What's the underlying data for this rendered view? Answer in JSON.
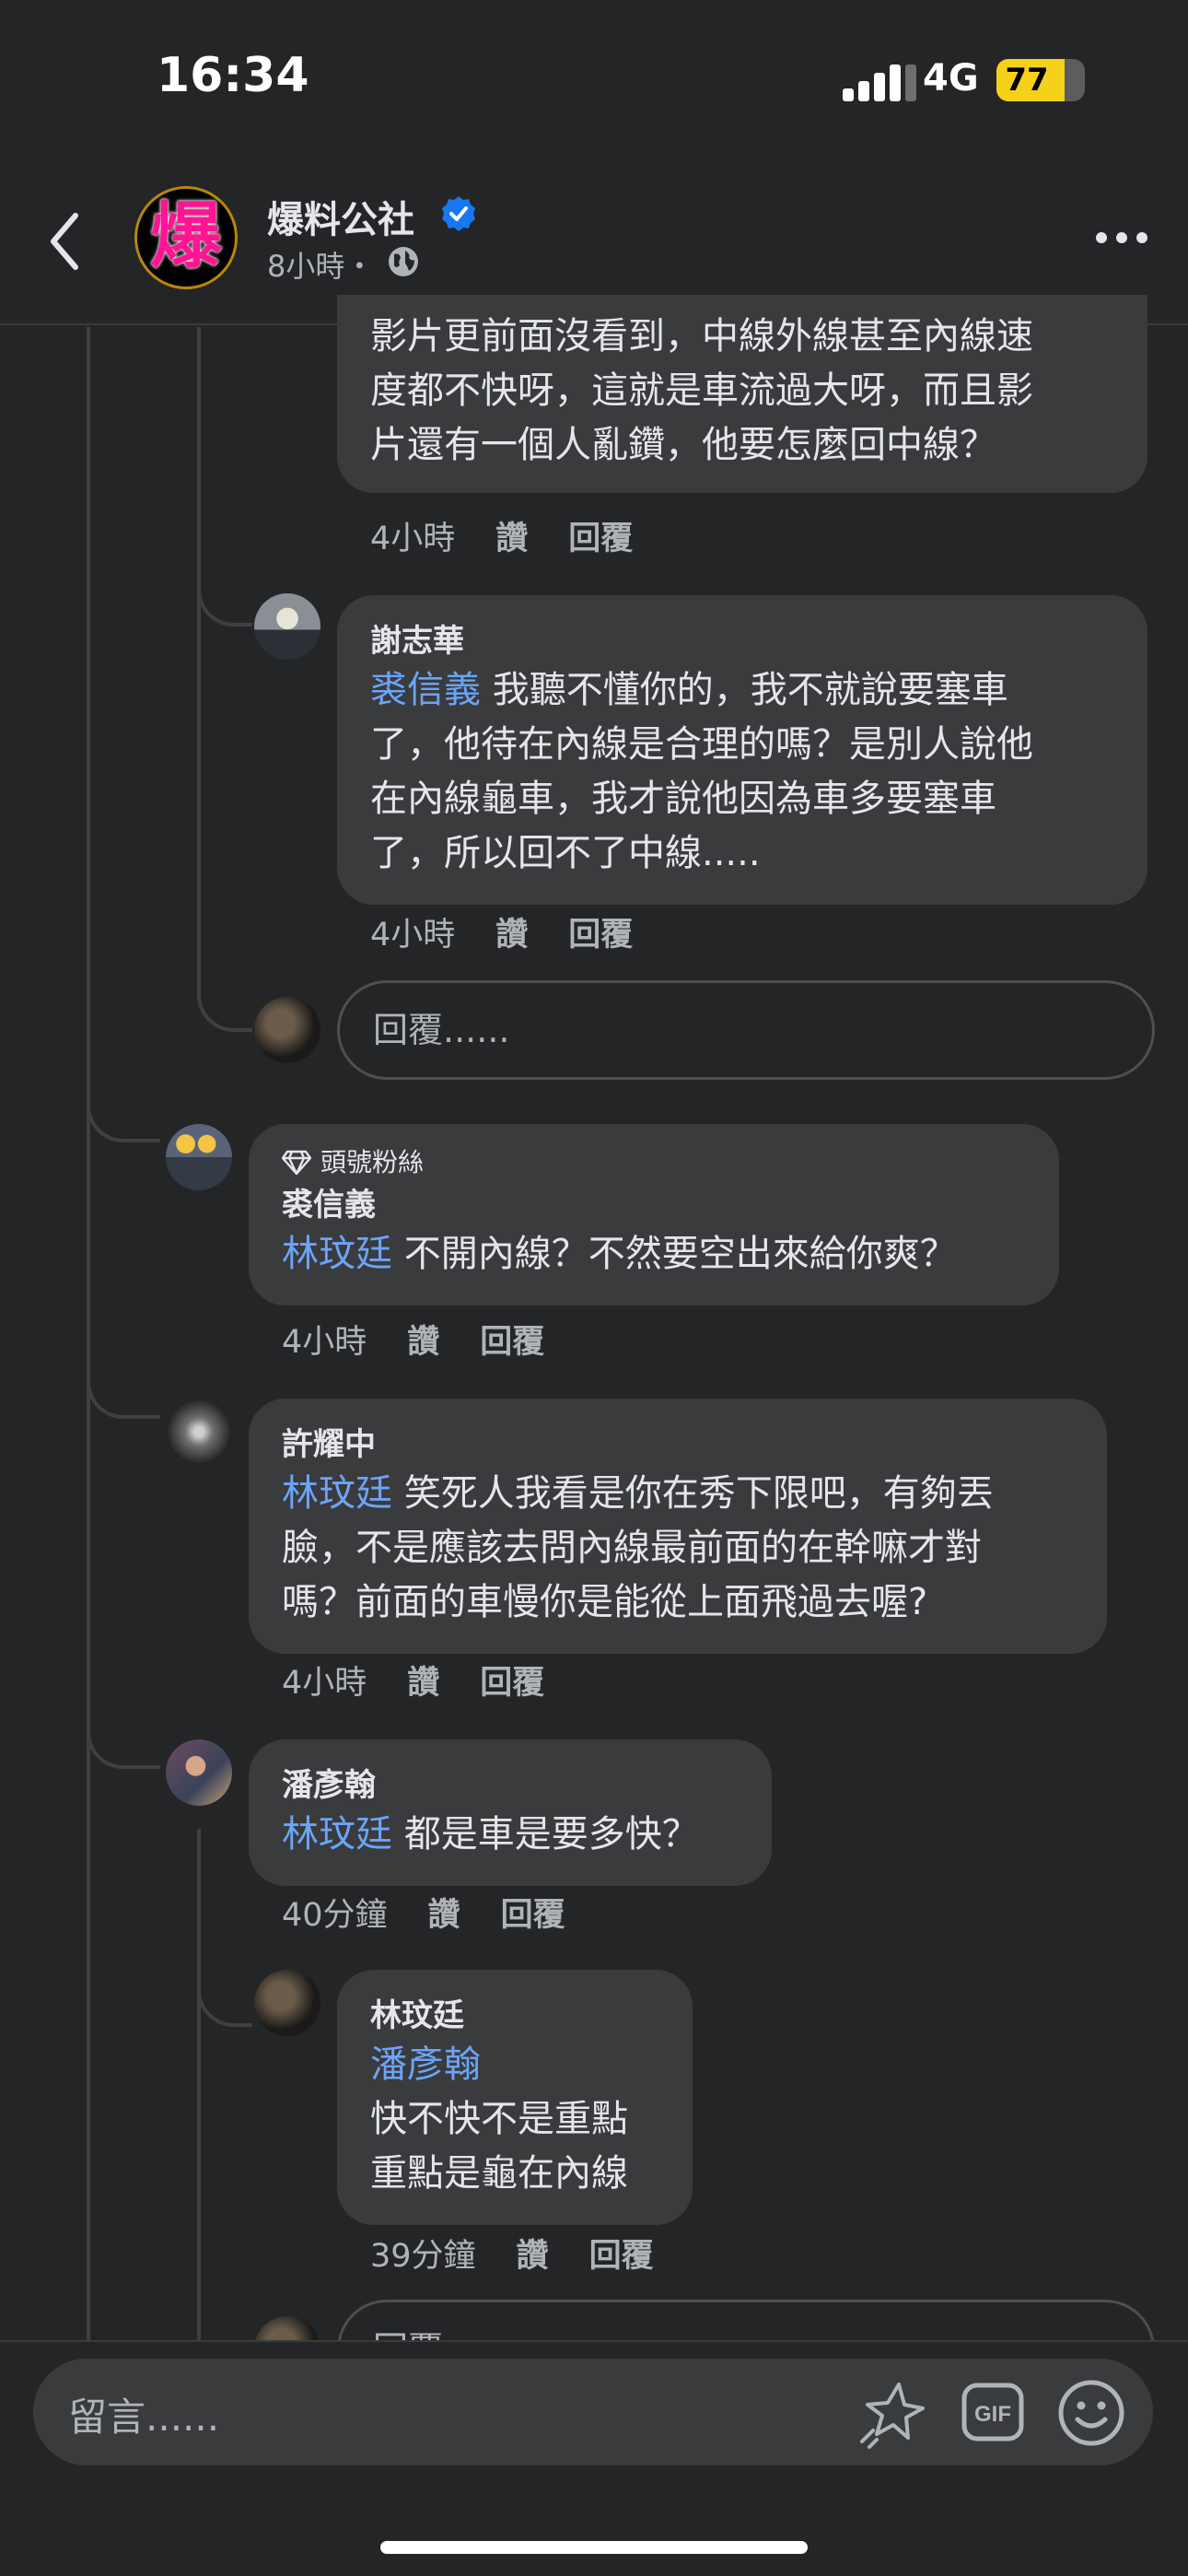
{
  "status_bar": {
    "time": "16:34",
    "network": "4G",
    "battery": "77",
    "battery_level": 0.77
  },
  "header": {
    "page_name": "爆料公社",
    "page_avatar_text": "爆",
    "post_meta": "8小時・",
    "icons": [
      "back-icon",
      "verified-icon",
      "globe-icon",
      "more-icon"
    ]
  },
  "comments": [
    {
      "text_lines": [
        "影片更前面沒看到，中線外線甚至內線速",
        "度都不快呀，這就是車流過大呀，而且影",
        "片還有一個人亂鑽，他要怎麼回中線？"
      ],
      "time": "4小時",
      "like": "讚",
      "reply": "回覆"
    },
    {
      "name": "謝志華",
      "mention": "裘信義",
      "text_lines": [
        " 我聽不懂你的，我不就說要塞車",
        "了，他待在內線是合理的嗎？是別人說他",
        "在內線龜車，我才說他因為車多要塞車",
        "了，所以回不了中線....."
      ],
      "time": "4小時",
      "like": "讚",
      "reply": "回覆"
    },
    {
      "badge": "頭號粉絲",
      "name": "裘信義",
      "mention": "林玟廷",
      "text_lines": [
        " 不開內線？不然要空出來給你爽？"
      ],
      "time": "4小時",
      "like": "讚",
      "reply": "回覆"
    },
    {
      "name": "許耀中",
      "mention": "林玟廷",
      "text_lines": [
        " 笑死人我看是你在秀下限吧，有夠丟",
        "臉，不是應該去問內線最前面的在幹嘛才對",
        "嗎？前面的車慢你是能從上面飛過去喔?"
      ],
      "time": "4小時",
      "like": "讚",
      "reply": "回覆"
    },
    {
      "name": "潘彥翰",
      "mention": "林玟廷",
      "text_lines": [
        " 都是車是要多快？"
      ],
      "time": "40分鐘",
      "like": "讚",
      "reply": "回覆"
    },
    {
      "name": "林玟廷",
      "mention": "潘彥翰",
      "text_lines": [
        "快不快不是重點",
        "重點是龜在內線"
      ],
      "time": "39分鐘",
      "like": "讚",
      "reply": "回覆"
    }
  ],
  "reply_placeholder": "回覆......",
  "reply_placeholder_partial": "回覆",
  "composer": {
    "placeholder": "留言......",
    "icons": [
      "sparkle-icon",
      "gif-icon",
      "emoji-icon"
    ]
  },
  "colors": {
    "background": "#242526",
    "bubble": "#3a3b3c",
    "mention": "#6ba4f8",
    "verified": "#1877f2",
    "battery": "#f6d11a"
  }
}
